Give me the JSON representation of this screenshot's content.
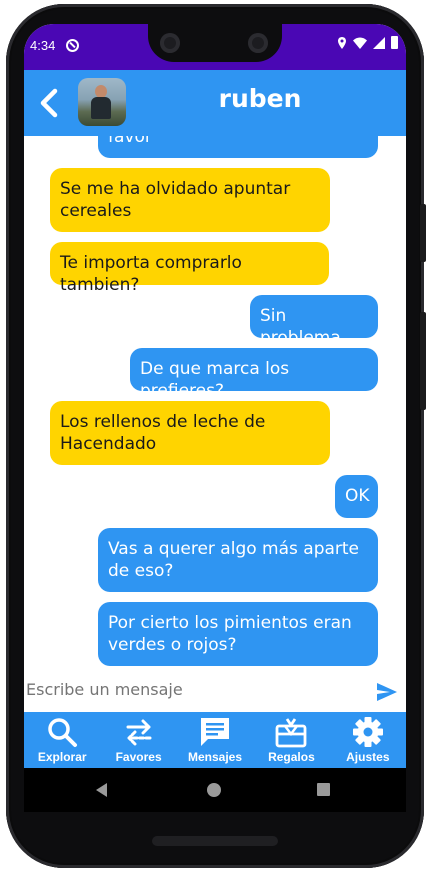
{
  "status_bar": {
    "time": "4:34"
  },
  "chat_header": {
    "contact_name": "ruben"
  },
  "messages": [
    {
      "text": "favor",
      "direction": "outgoing"
    },
    {
      "text": "Se me ha olvidado apuntar cereales",
      "direction": "incoming"
    },
    {
      "text": "Te importa comprarlo tambien?",
      "direction": "incoming"
    },
    {
      "text": "Sin problema",
      "direction": "outgoing"
    },
    {
      "text": "De que marca los prefieres?",
      "direction": "outgoing"
    },
    {
      "text": "Los rellenos de leche de Hacendado",
      "direction": "incoming"
    },
    {
      "text": "OK",
      "direction": "outgoing"
    },
    {
      "text": "Vas a querer algo más aparte de eso?",
      "direction": "outgoing"
    },
    {
      "text": "Por cierto los pimientos eran verdes o rojos?",
      "direction": "outgoing"
    }
  ],
  "composer": {
    "placeholder": "Escribe un mensaje"
  },
  "bottom_nav": [
    {
      "label": "Explorar",
      "icon": "search-icon"
    },
    {
      "label": "Favores",
      "icon": "swap-icon"
    },
    {
      "label": "Mensajes",
      "icon": "chat-icon"
    },
    {
      "label": "Regalos",
      "icon": "gift-icon"
    },
    {
      "label": "Ajustes",
      "icon": "gear-icon"
    }
  ],
  "colors": {
    "status_bar": "#4a07b4",
    "primary": "#2f95f2",
    "incoming_bubble": "#ffd400",
    "outgoing_bubble": "#2f95f2"
  }
}
